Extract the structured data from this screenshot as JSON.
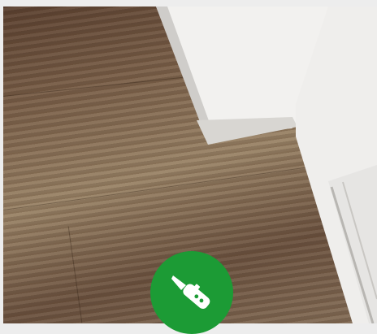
{
  "scene": {
    "description_tags": [
      "wood-floor",
      "wall-corner",
      "door-frame"
    ],
    "colors": {
      "floor_dark": "#5a4030",
      "floor_light": "#9a8468",
      "wall": "#f2f1ef",
      "trim": "#d8d6d2",
      "badge": "#1c9b35",
      "page_background": "#ededed"
    }
  },
  "badge": {
    "icon": "utility-knife-icon"
  }
}
